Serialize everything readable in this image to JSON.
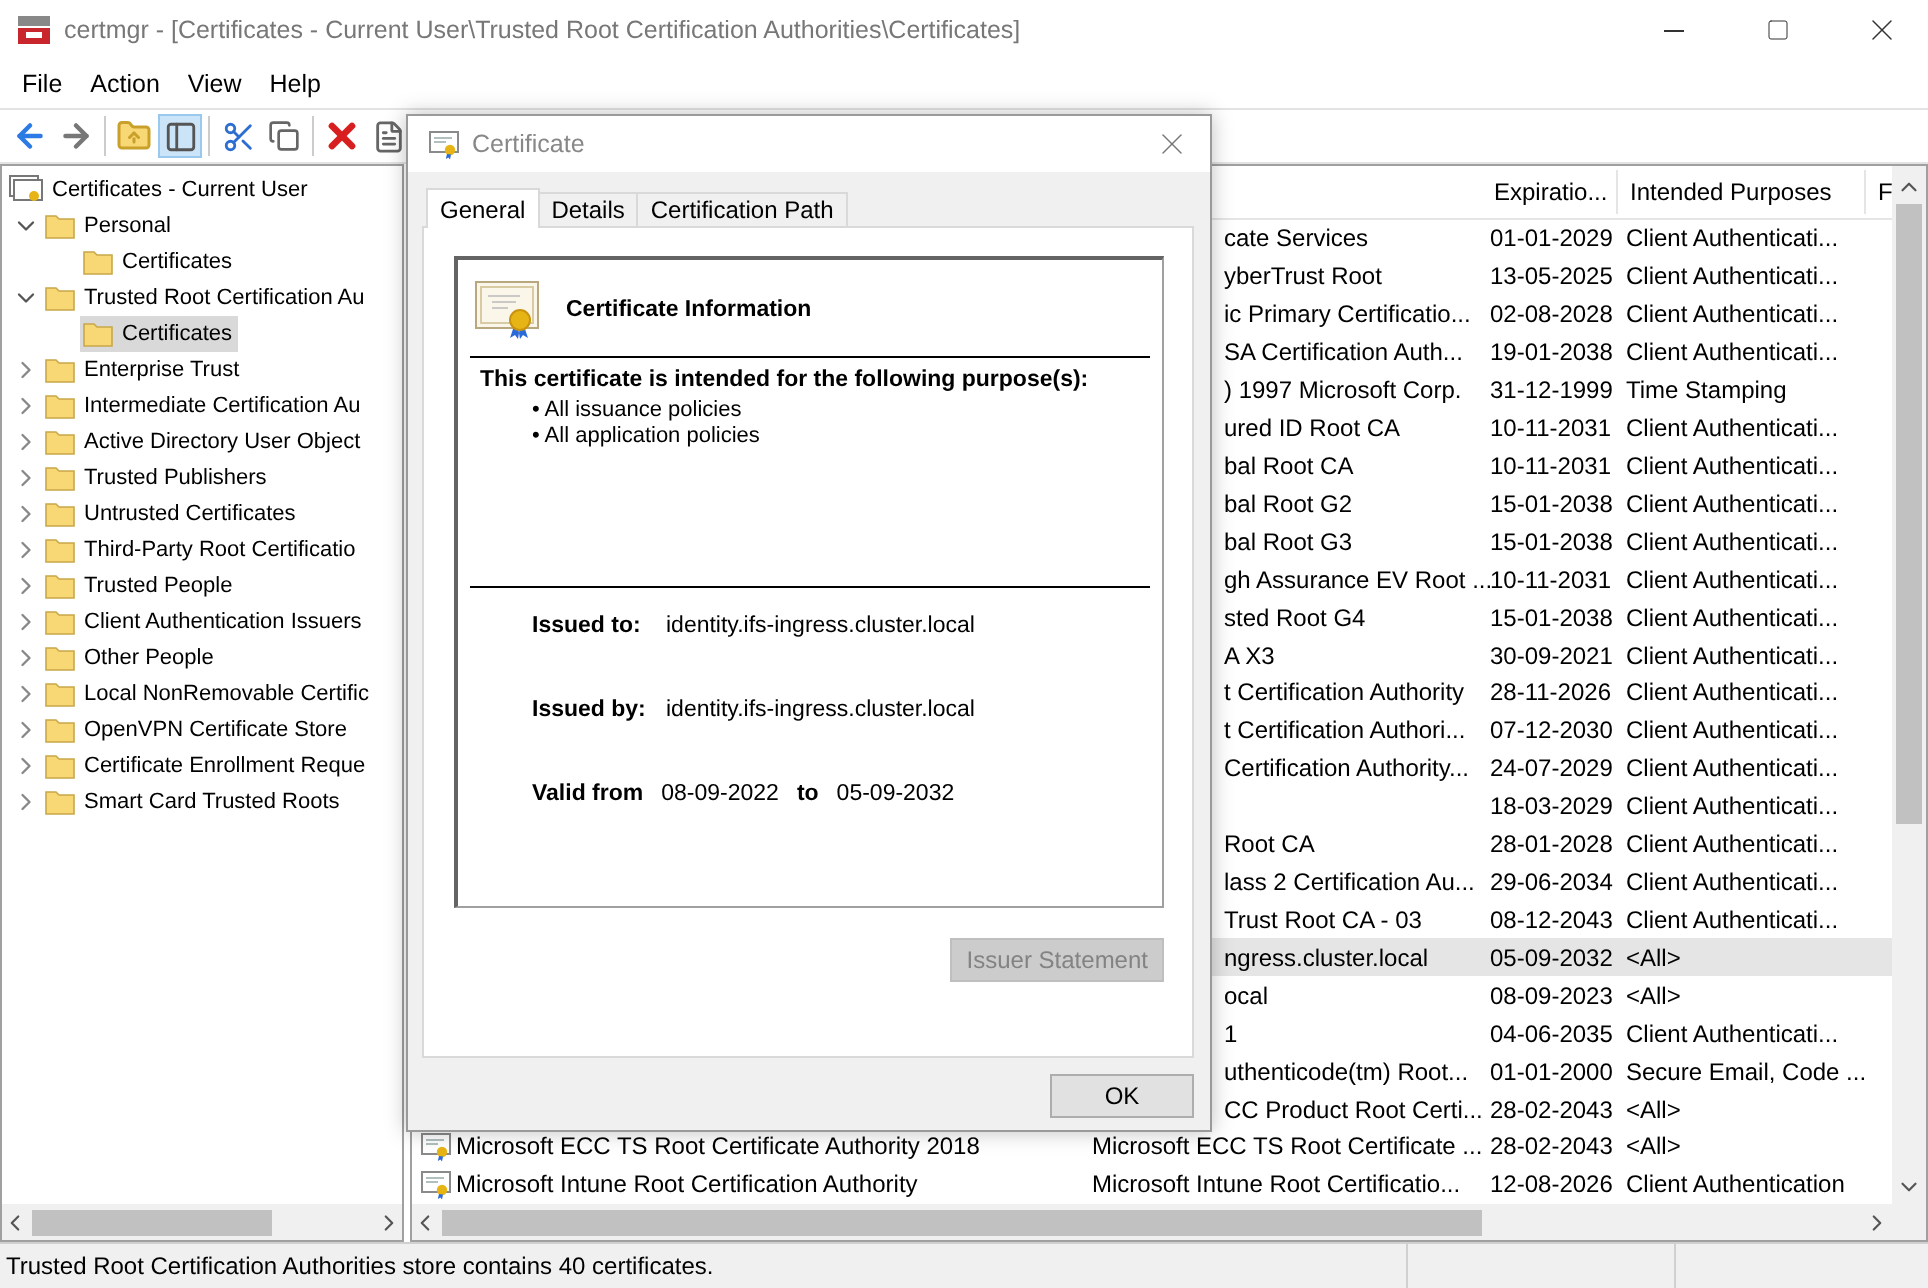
{
  "window": {
    "title": "certmgr - [Certificates - Current User\\Trusted Root Certification Authorities\\Certificates]"
  },
  "menu": [
    "File",
    "Action",
    "View",
    "Help"
  ],
  "toolbar": [
    {
      "kind": "back"
    },
    {
      "kind": "forward"
    },
    {
      "kind": "sep"
    },
    {
      "kind": "up"
    },
    {
      "kind": "tree",
      "pressed": true
    },
    {
      "kind": "sep"
    },
    {
      "kind": "cut"
    },
    {
      "kind": "copy"
    },
    {
      "kind": "sep"
    },
    {
      "kind": "delete"
    },
    {
      "kind": "properties"
    }
  ],
  "tree": {
    "label": "Certificates - Current User",
    "children": [
      {
        "label": "Personal",
        "expanded": true,
        "selected": false,
        "children": [
          {
            "label": "Certificates",
            "selected": false
          }
        ]
      },
      {
        "label": "Trusted Root Certification Au",
        "expanded": true,
        "selected": false,
        "children": [
          {
            "label": "Certificates",
            "selected": true
          }
        ]
      },
      {
        "label": "Enterprise Trust",
        "expanded": false,
        "selected": false
      },
      {
        "label": "Intermediate Certification Au",
        "expanded": false,
        "selected": false
      },
      {
        "label": "Active Directory User Object",
        "expanded": false,
        "selected": false
      },
      {
        "label": "Trusted Publishers",
        "expanded": false,
        "selected": false
      },
      {
        "label": "Untrusted Certificates",
        "expanded": false,
        "selected": false
      },
      {
        "label": "Third-Party Root Certificatio",
        "expanded": false,
        "selected": false
      },
      {
        "label": "Trusted People",
        "expanded": false,
        "selected": false
      },
      {
        "label": "Client Authentication Issuers",
        "expanded": false,
        "selected": false
      },
      {
        "label": "Other People",
        "expanded": false,
        "selected": false
      },
      {
        "label": "Local NonRemovable Certific",
        "expanded": false,
        "selected": false
      },
      {
        "label": "OpenVPN Certificate Store",
        "expanded": false,
        "selected": false
      },
      {
        "label": "Certificate Enrollment Reque",
        "expanded": false,
        "selected": false
      },
      {
        "label": "Smart Card Trusted Roots",
        "expanded": false,
        "selected": false
      }
    ]
  },
  "list": {
    "columns": [
      "Expiratio...",
      "Intended Purposes",
      "F"
    ],
    "rows": [
      {
        "issued_by": "cate Services",
        "expiration": "01-01-2029",
        "purposes": "Client Authenticati...",
        "selected": false
      },
      {
        "issued_by": "yberTrust Root",
        "expiration": "13-05-2025",
        "purposes": "Client Authenticati...",
        "selected": false
      },
      {
        "issued_by": "ic Primary Certificatio...",
        "expiration": "02-08-2028",
        "purposes": "Client Authenticati...",
        "selected": false
      },
      {
        "issued_by": "SA Certification Auth...",
        "expiration": "19-01-2038",
        "purposes": "Client Authenticati...",
        "selected": false
      },
      {
        "issued_by": ") 1997 Microsoft Corp.",
        "expiration": "31-12-1999",
        "purposes": "Time Stamping",
        "selected": false
      },
      {
        "issued_by": "ured ID Root CA",
        "expiration": "10-11-2031",
        "purposes": "Client Authenticati...",
        "selected": false
      },
      {
        "issued_by": "bal Root CA",
        "expiration": "10-11-2031",
        "purposes": "Client Authenticati...",
        "selected": false
      },
      {
        "issued_by": "bal Root G2",
        "expiration": "15-01-2038",
        "purposes": "Client Authenticati...",
        "selected": false
      },
      {
        "issued_by": "bal Root G3",
        "expiration": "15-01-2038",
        "purposes": "Client Authenticati...",
        "selected": false
      },
      {
        "issued_by": "gh Assurance EV Root ...",
        "expiration": "10-11-2031",
        "purposes": "Client Authenticati...",
        "selected": false
      },
      {
        "issued_by": "sted Root G4",
        "expiration": "15-01-2038",
        "purposes": "Client Authenticati...",
        "selected": false
      },
      {
        "issued_by": "A X3",
        "expiration": "30-09-2021",
        "purposes": "Client Authenticati...",
        "selected": false
      },
      {
        "issued_by": "t Certification Authority",
        "expiration": "28-11-2026",
        "purposes": "Client Authenticati...",
        "selected": false
      },
      {
        "issued_by": "t Certification Authori...",
        "expiration": "07-12-2030",
        "purposes": "Client Authenticati...",
        "selected": false
      },
      {
        "issued_by": "Certification Authority...",
        "expiration": "24-07-2029",
        "purposes": "Client Authenticati...",
        "selected": false
      },
      {
        "expiration": "18-03-2029",
        "purposes": "Client Authenticati...",
        "selected": false
      },
      {
        "issued_by": "Root CA",
        "expiration": "28-01-2028",
        "purposes": "Client Authenticati...",
        "selected": false
      },
      {
        "issued_by": "lass 2 Certification Au...",
        "expiration": "29-06-2034",
        "purposes": "Client Authenticati...",
        "selected": false
      },
      {
        "issued_by": "Trust Root CA - 03",
        "expiration": "08-12-2043",
        "purposes": "Client Authenticati...",
        "selected": false
      },
      {
        "issued_by": "ngress.cluster.local",
        "expiration": "05-09-2032",
        "purposes": "<All>",
        "selected": true
      },
      {
        "issued_by": "ocal",
        "expiration": "08-09-2023",
        "purposes": "<All>",
        "selected": false
      },
      {
        "issued_by": "1",
        "expiration": "04-06-2035",
        "purposes": "Client Authenticati...",
        "selected": false
      },
      {
        "issued_by": "uthenticode(tm) Root...",
        "expiration": "01-01-2000",
        "purposes": "Secure Email, Code ...",
        "selected": false
      },
      {
        "issued_by": "CC Product Root Certi...",
        "expiration": "28-02-2043",
        "purposes": "<All>",
        "selected": false
      },
      {
        "issued_to": "Microsoft ECC TS Root Certificate Authority 2018",
        "issued_by": "Microsoft ECC TS Root Certificate ...",
        "expiration": "28-02-2043",
        "purposes": "<All>",
        "selected": false
      },
      {
        "issued_to": "Microsoft Intune Root Certification Authority",
        "issued_by": "Microsoft Intune Root Certificatio...",
        "expiration": "12-08-2026",
        "purposes": "Client Authentication",
        "selected": false
      }
    ]
  },
  "status_bar": {
    "text": "Trusted Root Certification Authorities store contains 40 certificates."
  },
  "dialog": {
    "title": "Certificate",
    "tabs": [
      {
        "label": "General",
        "selected": true
      },
      {
        "label": "Details",
        "selected": false
      },
      {
        "label": "Certification Path",
        "selected": false
      }
    ],
    "heading": "Certificate Information",
    "purpose_heading": "This certificate is intended for the following purpose(s):",
    "purposes": [
      "• All issuance policies",
      "• All application policies"
    ],
    "issued_to_label": "Issued to:",
    "issued_to": "identity.ifs-ingress.cluster.local",
    "issued_by_label": "Issued by:",
    "issued_by": "identity.ifs-ingress.cluster.local",
    "valid_from_label": "Valid from",
    "valid_from": "08-09-2022",
    "valid_to_label": "to",
    "valid_to": "05-09-2032",
    "issuer_button": {
      "label": "Issuer Statement",
      "disabled": true
    },
    "ok_button": {
      "label": "OK"
    }
  }
}
